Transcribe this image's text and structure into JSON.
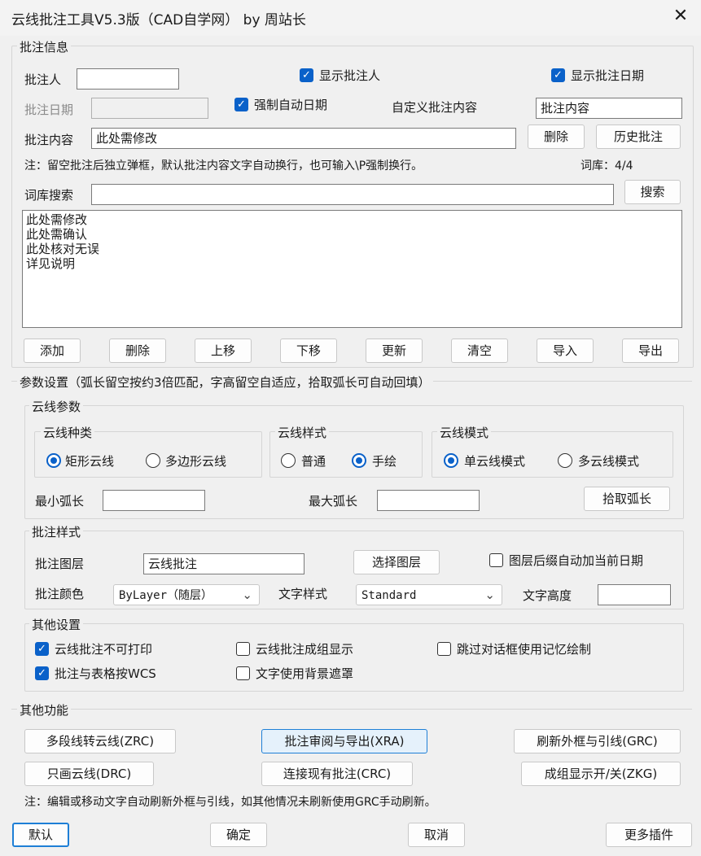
{
  "window": {
    "title": "云线批注工具V5.3版（CAD自学网） by 周站长",
    "close_icon": "close-icon"
  },
  "annotation_info": {
    "legend": "批注信息",
    "annotator_label": "批注人",
    "annotator_value": "",
    "show_annotator": {
      "label": "显示批注人",
      "checked": true
    },
    "show_date": {
      "label": "显示批注日期",
      "checked": true
    },
    "date_label": "批注日期",
    "date_value": "",
    "force_auto_date": {
      "label": "强制自动日期",
      "checked": true
    },
    "custom_content_label": "自定义批注内容",
    "custom_content_value": "批注内容",
    "content_label": "批注内容",
    "content_value": "此处需修改",
    "delete_btn": "删除",
    "history_btn": "历史批注",
    "note": "注：留空批注后独立弹框，默认批注内容文字自动换行，也可输入\\P强制换行。",
    "lib_count": "词库：4/4",
    "search_label": "词库搜索",
    "search_value": "",
    "search_btn": "搜索",
    "list_items": [
      "此处需修改",
      "此处需确认",
      "此处核对无误",
      "详见说明"
    ],
    "actions": [
      "添加",
      "删除",
      "上移",
      "下移",
      "更新",
      "清空",
      "导入",
      "导出"
    ]
  },
  "params": {
    "legend": "参数设置（弧长留空按约3倍匹配，字高留空自适应，拾取弧长可自动回填）",
    "cloud_params": {
      "legend": "云线参数",
      "type": {
        "legend": "云线种类",
        "options": [
          "矩形云线",
          "多边形云线"
        ],
        "selected": 0
      },
      "style": {
        "legend": "云线样式",
        "options": [
          "普通",
          "手绘"
        ],
        "selected": 1
      },
      "mode": {
        "legend": "云线模式",
        "options": [
          "单云线模式",
          "多云线模式"
        ],
        "selected": 0
      },
      "min_arc_label": "最小弧长",
      "min_arc_value": "",
      "max_arc_label": "最大弧长",
      "max_arc_value": "",
      "pick_arc_btn": "拾取弧长"
    },
    "annotation_style": {
      "legend": "批注样式",
      "layer_label": "批注图层",
      "layer_value": "云线批注",
      "select_layer_btn": "选择图层",
      "layer_date_suffix": {
        "label": "图层后缀自动加当前日期",
        "checked": false
      },
      "color_label": "批注颜色",
      "color_value": "ByLayer（随层）",
      "text_style_label": "文字样式",
      "text_style_value": "Standard",
      "text_height_label": "文字高度",
      "text_height_value": ""
    },
    "other_settings": {
      "legend": "其他设置",
      "no_print": {
        "label": "云线批注不可打印",
        "checked": true
      },
      "group_display": {
        "label": "云线批注成组显示",
        "checked": false
      },
      "skip_dialog": {
        "label": "跳过对话框使用记忆绘制",
        "checked": false
      },
      "table_wcs": {
        "label": "批注与表格按WCS",
        "checked": true
      },
      "text_mask": {
        "label": "文字使用背景遮罩",
        "checked": false
      }
    }
  },
  "other_functions": {
    "legend": "其他功能",
    "btn_zrc": "多段线转云线(ZRC)",
    "btn_xra": "批注审阅与导出(XRA)",
    "btn_grc": "刷新外框与引线(GRC)",
    "btn_drc": "只画云线(DRC)",
    "btn_crc": "连接现有批注(CRC)",
    "btn_zkg": "成组显示开/关(ZKG)",
    "note": "注：编辑或移动文字自动刷新外框与引线，如其他情况未刷新使用GRC手动刷新。"
  },
  "footer": {
    "default_btn": "默认",
    "ok_btn": "确定",
    "cancel_btn": "取消",
    "more_btn": "更多插件"
  },
  "colors": {
    "accent": "#0a61c9",
    "highlight_bg": "#e5f1fb",
    "highlight_border": "#1e7fd6"
  }
}
